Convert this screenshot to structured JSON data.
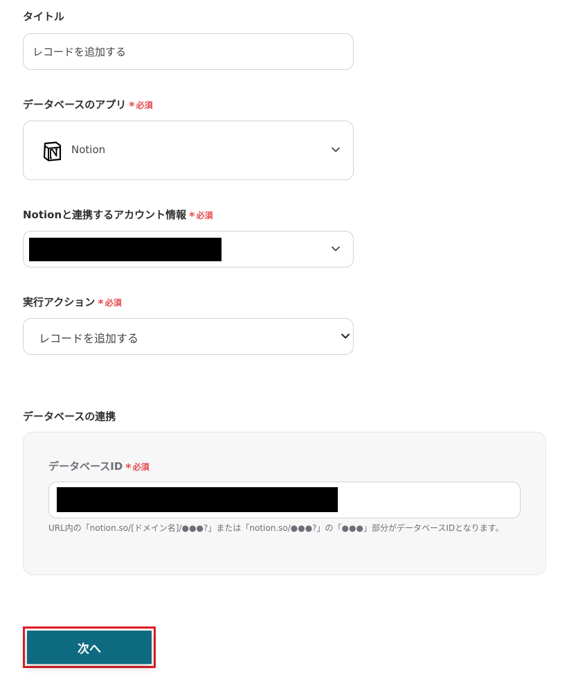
{
  "title_field": {
    "label": "タイトル",
    "value": "レコードを追加する"
  },
  "db_app_field": {
    "label": "データベースのアプリ",
    "required": "必須",
    "value": "Notion",
    "icon": "notion-icon"
  },
  "account_field": {
    "label": "Notionと連携するアカウント情報",
    "required": "必須"
  },
  "action_field": {
    "label": "実行アクション",
    "required": "必須",
    "value": "レコードを追加する"
  },
  "db_link_section": {
    "heading": "データベースの連携",
    "db_id_label": "データベースID",
    "required": "必須",
    "hint": "URL内の「notion.so/[ドメイン名]/●●●?」または「notion.so/●●●?」の「●●●」部分がデータベースIDとなります。"
  },
  "next_button": {
    "label": "次へ"
  },
  "colors": {
    "required": "#e5484d",
    "primary": "#0e6a80",
    "highlight": "#e11d26"
  }
}
